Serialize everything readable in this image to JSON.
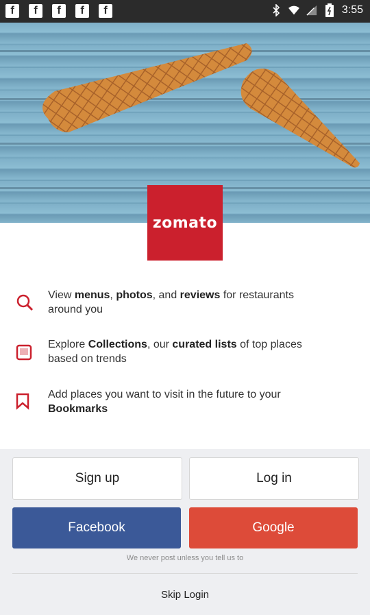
{
  "status_bar": {
    "time": "3:55",
    "notification_icons": [
      "facebook-icon",
      "facebook-icon",
      "facebook-icon",
      "facebook-icon",
      "facebook-icon"
    ],
    "system_icons": [
      "bluetooth-icon",
      "wifi-icon",
      "signal-icon",
      "battery-icon"
    ]
  },
  "brand": {
    "logo_text": "zomato",
    "color": "#cb202d"
  },
  "features": [
    {
      "icon": "search-icon",
      "text_parts": [
        "View ",
        "menus",
        ", ",
        "photos",
        ", and ",
        "reviews",
        " for restaurants around you"
      ]
    },
    {
      "icon": "collections-icon",
      "text_parts": [
        "Explore ",
        "Collections",
        ", our ",
        "curated lists",
        " of top places based on trends"
      ]
    },
    {
      "icon": "bookmark-icon",
      "text_parts": [
        "Add places you want to visit in the future to your ",
        "Bookmarks",
        "",
        "",
        "",
        "",
        ""
      ]
    }
  ],
  "auth": {
    "signup_label": "Sign up",
    "login_label": "Log in",
    "facebook_label": "Facebook",
    "google_label": "Google",
    "facebook_color": "#3b5998",
    "google_color": "#dd4b39",
    "disclaimer": "We never post unless you tell us to",
    "skip_label": "Skip Login"
  }
}
